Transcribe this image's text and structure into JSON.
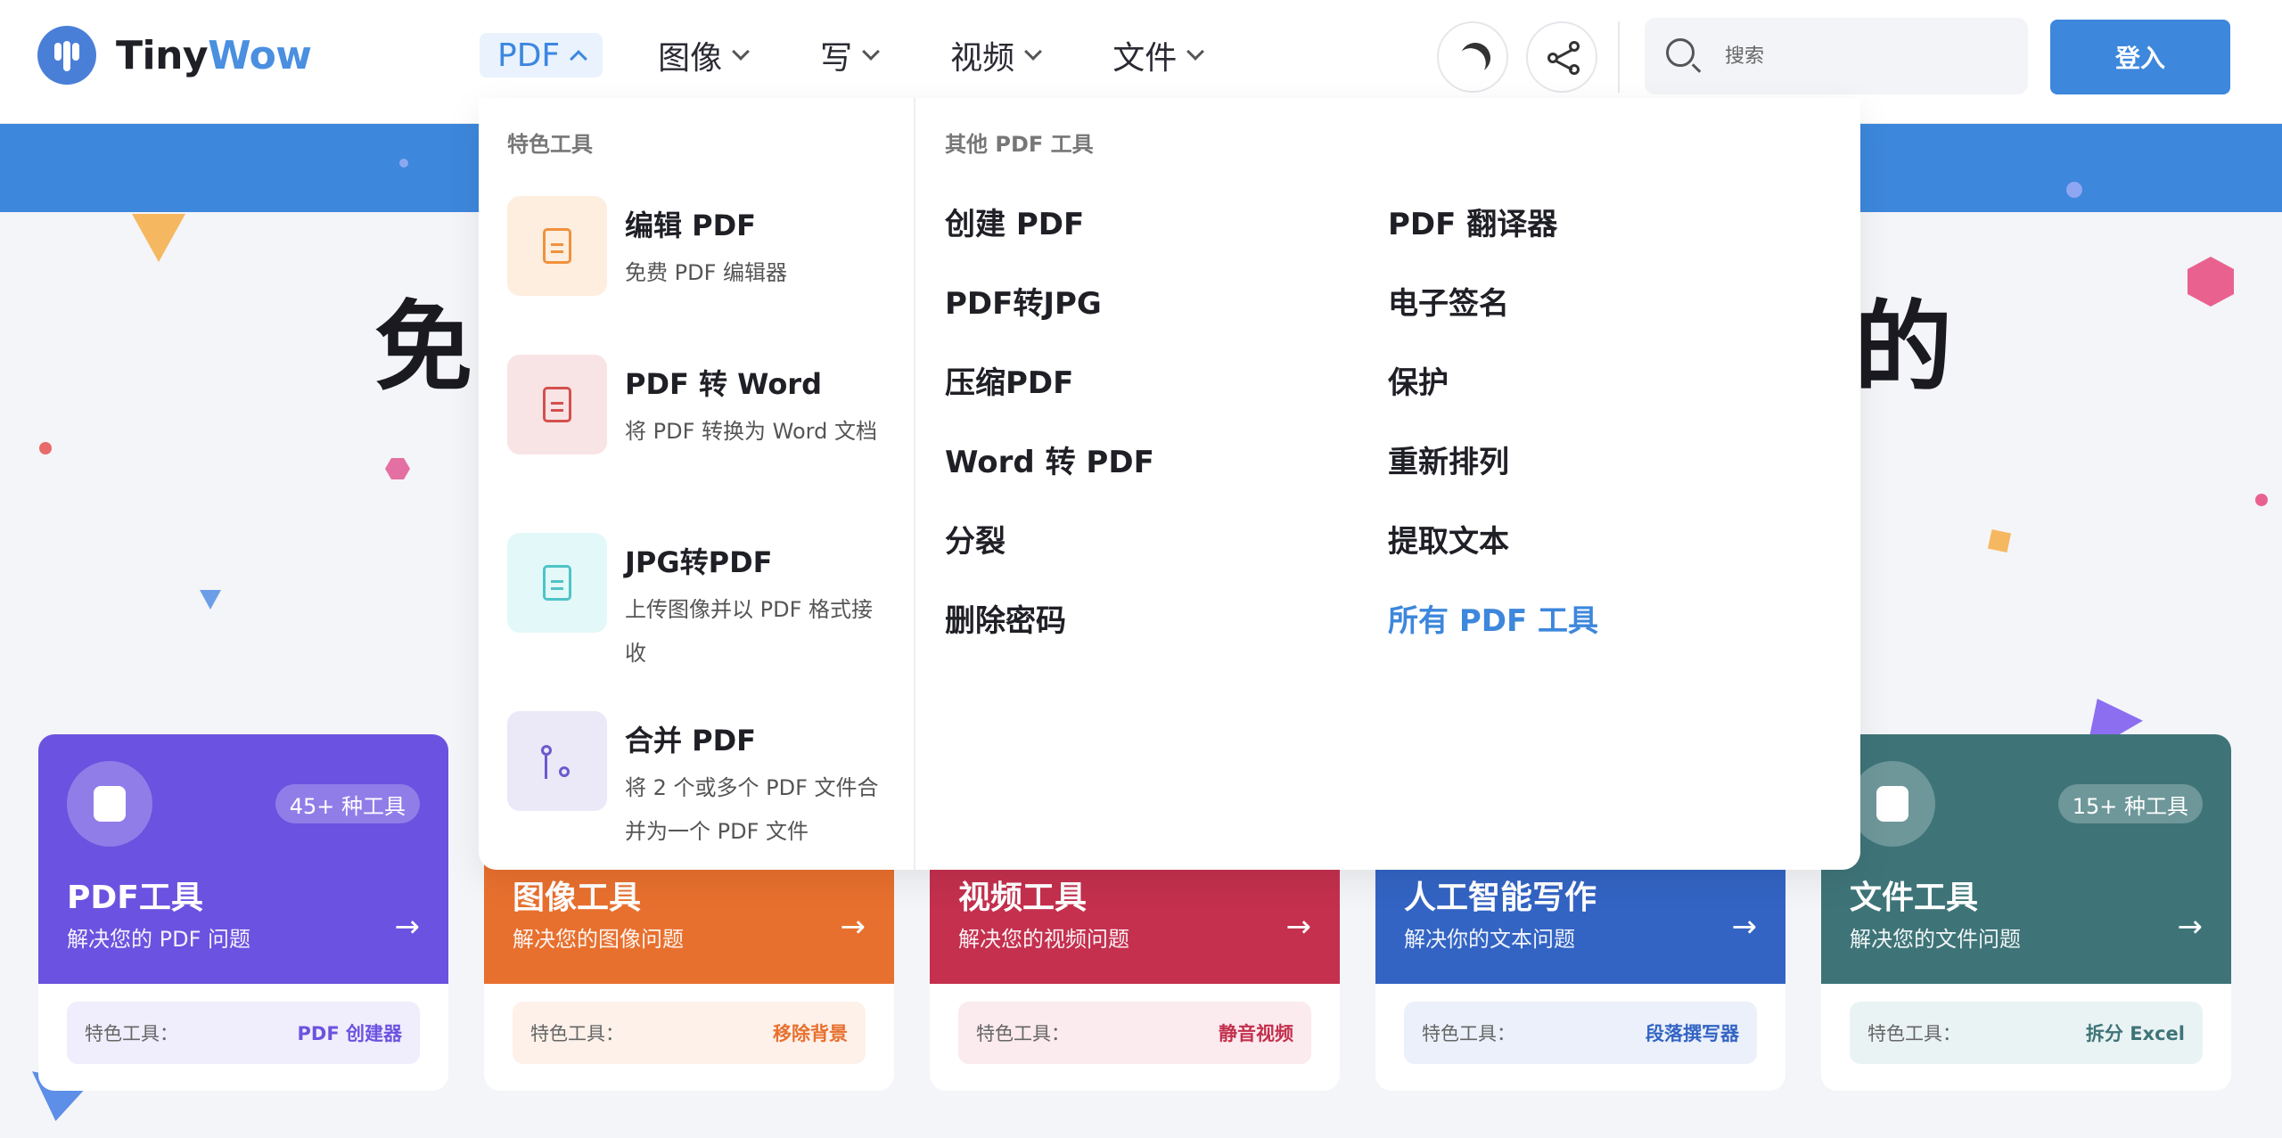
{
  "brand": {
    "name_part1": "Tiny",
    "name_part2": "Wow",
    "color": "#4a8fe0"
  },
  "nav": [
    {
      "label": "PDF",
      "active": true
    },
    {
      "label": "图像",
      "active": false
    },
    {
      "label": "写",
      "active": false
    },
    {
      "label": "视频",
      "active": false
    },
    {
      "label": "文件",
      "active": false
    }
  ],
  "header": {
    "theme_icon": "moon-icon",
    "share_icon": "share-icon",
    "search_placeholder": "搜索",
    "login_label": "登入"
  },
  "hero": {
    "title_left": "免",
    "title_right": "的"
  },
  "dropdown": {
    "featured_heading": "特色工具",
    "other_heading": "其他 PDF 工具",
    "featured": [
      {
        "title": "编辑 PDF",
        "desc": "免费 PDF 编辑器",
        "icon": "edit-doc-icon",
        "color": "#f0913c",
        "bg": "#fdeedf"
      },
      {
        "title": "PDF 转 Word",
        "desc": "将 PDF 转换为 Word 文档",
        "icon": "word-doc-icon",
        "color": "#d4504d",
        "bg": "#f8e4e4"
      },
      {
        "title": "JPG转PDF",
        "desc": "上传图像并以 PDF 格式接收",
        "icon": "image-doc-icon",
        "color": "#4ec3c7",
        "bg": "#e3f8f8"
      },
      {
        "title": "合并 PDF",
        "desc": "将 2 个或多个 PDF 文件合并为一个 PDF 文件",
        "icon": "merge-icon",
        "color": "#6a5acd",
        "bg": "#ebe8f8"
      }
    ],
    "tools_col1": [
      "创建 PDF",
      "PDF转JPG",
      "压缩PDF",
      "Word 转 PDF",
      "分裂",
      "删除密码"
    ],
    "tools_col2": [
      "PDF 翻译器",
      "电子签名",
      "保护",
      "重新排列",
      "提取文本"
    ],
    "all_tools_link": "所有 PDF 工具",
    "accent_color": "#3d87dc"
  },
  "cards": [
    {
      "title": "PDF工具",
      "sub": "解决您的 PDF 问题",
      "badge": "45+ 种工具",
      "foot_label": "特色工具：",
      "foot_value": "PDF 创建器",
      "color": "#6c52e0",
      "tint": "#f0edfc",
      "val_color": "#6c52e0"
    },
    {
      "title": "图像工具",
      "sub": "解决您的图像问题",
      "badge": "",
      "foot_label": "特色工具：",
      "foot_value": "移除背景",
      "color": "#e8702e",
      "tint": "#fdf1ea",
      "val_color": "#e8702e"
    },
    {
      "title": "视频工具",
      "sub": "解决您的视频问题",
      "badge": "",
      "foot_label": "特色工具：",
      "foot_value": "静音视频",
      "color": "#c4304e",
      "tint": "#fbeaee",
      "val_color": "#c4304e"
    },
    {
      "title": "人工智能写作",
      "sub": "解决你的文本问题",
      "badge": "",
      "foot_label": "特色工具：",
      "foot_value": "段落撰写器",
      "color": "#3364c4",
      "tint": "#ebf0fa",
      "val_color": "#3364c4"
    },
    {
      "title": "文件工具",
      "sub": "解决您的文件问题",
      "badge": "15+ 种工具",
      "foot_label": "特色工具：",
      "foot_value": "拆分 Excel",
      "color": "#3e7478",
      "tint": "#eaf3f4",
      "val_color": "#3e7478"
    }
  ],
  "card_arrow": "→"
}
